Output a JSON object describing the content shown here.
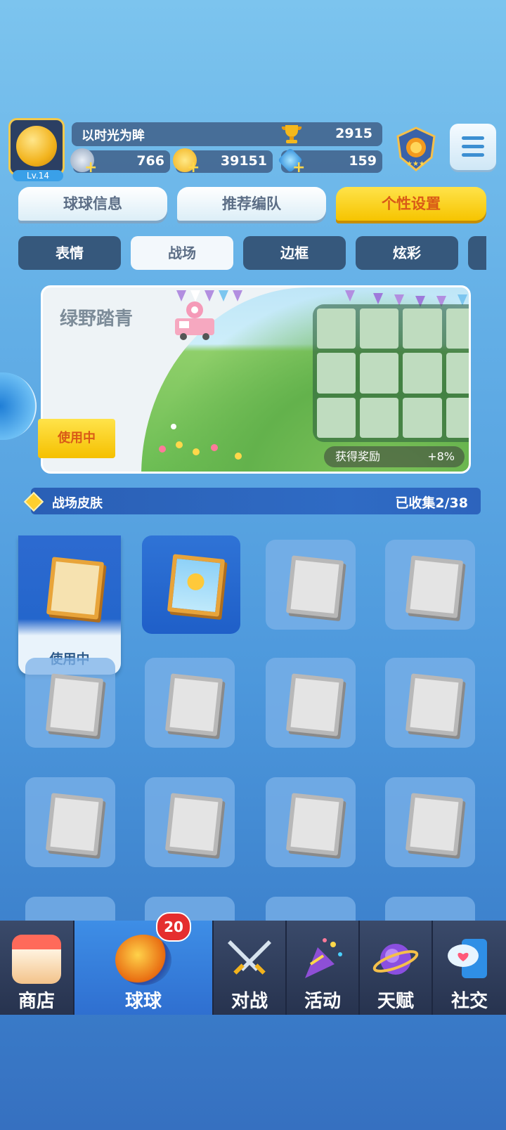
{
  "player": {
    "name": "以时光为眸",
    "level": "Lv.14",
    "trophies": "2915",
    "stars": "766",
    "coins": "39151",
    "gems": "159"
  },
  "main_tabs": [
    {
      "label": "球球信息",
      "selected": false
    },
    {
      "label": "推荐编队",
      "selected": false
    },
    {
      "label": "个性设置",
      "selected": true
    }
  ],
  "sub_tabs": [
    {
      "label": "表情",
      "selected": false
    },
    {
      "label": "战场",
      "selected": true
    },
    {
      "label": "边框",
      "selected": false
    },
    {
      "label": "炫彩",
      "selected": false
    }
  ],
  "preview": {
    "title": "绿野踏青",
    "status": "使用中",
    "reward_label": "获得奖励",
    "reward_value": "+8%"
  },
  "collection": {
    "title": "战场皮肤",
    "count": "已收集2/38"
  },
  "skins": {
    "active_label": "使用中",
    "items": [
      {
        "state": "active",
        "icon": "picnic-frame-icon"
      },
      {
        "state": "owned",
        "icon": "sunny-frame-icon"
      },
      {
        "state": "locked",
        "icon": "snowflake-frame-icon"
      },
      {
        "state": "locked",
        "icon": "planet-frame-icon"
      },
      {
        "state": "locked",
        "icon": "coral-frame-icon"
      },
      {
        "state": "locked",
        "icon": "starfish-frame-icon"
      },
      {
        "state": "locked",
        "icon": "surfboard-frame-icon"
      },
      {
        "state": "locked",
        "icon": "gem-frame-icon"
      },
      {
        "state": "locked",
        "icon": "witch-frame-icon"
      },
      {
        "state": "locked",
        "icon": "candy-frame-icon"
      },
      {
        "state": "locked",
        "icon": "blank-frame-icon"
      },
      {
        "state": "locked",
        "icon": "spotlight-frame-icon"
      }
    ]
  },
  "nav": {
    "badge": "20",
    "items": [
      {
        "label": "商店",
        "icon": "shop-icon"
      },
      {
        "label": "球球",
        "icon": "ball-icon",
        "selected": true
      },
      {
        "label": "对战",
        "icon": "crossed-swords-icon"
      },
      {
        "label": "活动",
        "icon": "party-popper-icon"
      },
      {
        "label": "天赋",
        "icon": "planet-icon"
      },
      {
        "label": "社交",
        "icon": "chat-heart-icon"
      }
    ]
  },
  "colors": {
    "accent_yellow": "#f6c400",
    "accent_blue": "#2f6fd0",
    "dark_tab": "#36587c"
  }
}
